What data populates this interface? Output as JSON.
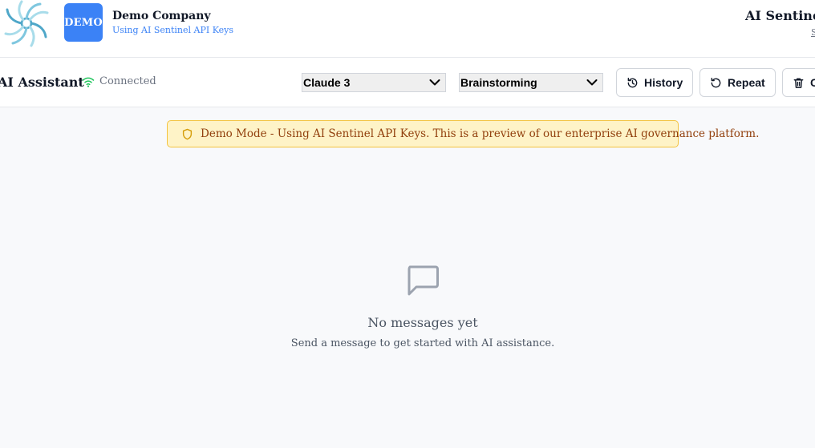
{
  "header": {
    "badge": "DEMO",
    "company_name": "Demo Company",
    "company_subtitle": "Using AI Sentinel API Keys",
    "product_name": "AI Sentinel",
    "product_subtitle": "S"
  },
  "toolbar": {
    "title": "AI Assistant",
    "status": "Connected",
    "status_color": "#22c55e",
    "model_select": {
      "selected": "Claude 3"
    },
    "mode_select": {
      "selected": "Brainstorming"
    },
    "buttons": {
      "history": "History",
      "repeat": "Repeat",
      "clear": "C"
    }
  },
  "banner": {
    "text": "Demo Mode - Using AI Sentinel API Keys. This is a preview of our enterprise AI governance platform."
  },
  "empty_state": {
    "title": "No messages yet",
    "subtitle": "Send a message to get started with AI assistance."
  },
  "colors": {
    "accent": "#3b82f6",
    "banner_bg": "#fef3c7",
    "banner_border": "#f3c33f",
    "banner_text": "#92400e"
  }
}
